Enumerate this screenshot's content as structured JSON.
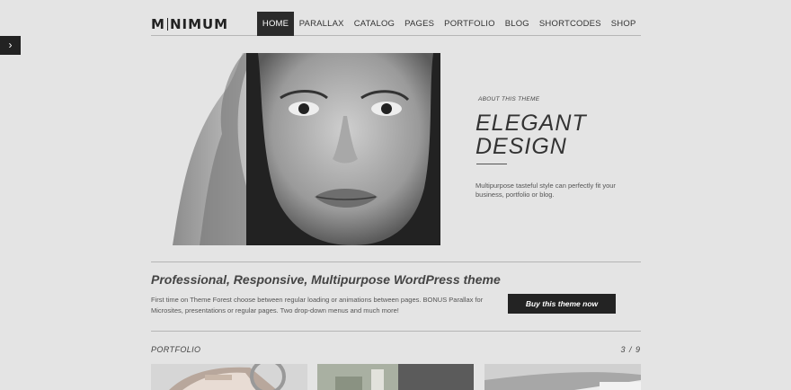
{
  "sidebar_toggle": {
    "icon": "chevron-right-icon",
    "glyph": "›"
  },
  "brand": {
    "name_start": "M",
    "name_end": "NIMUM"
  },
  "nav": {
    "items": [
      {
        "label": "HOME",
        "active": true
      },
      {
        "label": "PARALLAX",
        "active": false
      },
      {
        "label": "CATALOG",
        "active": false
      },
      {
        "label": "PAGES",
        "active": false
      },
      {
        "label": "PORTFOLIO",
        "active": false
      },
      {
        "label": "BLOG",
        "active": false
      },
      {
        "label": "SHORTCODES",
        "active": false
      },
      {
        "label": "SHOP",
        "active": false
      }
    ]
  },
  "hero": {
    "about_label": "ABOUT THIS THEME",
    "title_line1": "ELEGANT",
    "title_line2": "DESIGN",
    "description": "Multipurpose tasteful style can perfectly fit your business, portfolio or blog."
  },
  "promo": {
    "tagline": "Professional, Responsive, Multipurpose WordPress theme",
    "text": "First time on Theme Forest choose between regular loading or animations between pages. BONUS Parallax for Microsites, presentations or regular pages. Two drop-down menus and much more!",
    "button_label": "Buy this theme now"
  },
  "portfolio": {
    "label": "PORTFOLIO",
    "counter": "3 / 9"
  },
  "colors": {
    "background": "#e4e4e4",
    "dark": "#232323",
    "text": "#333333",
    "divider": "#b5b5b5"
  }
}
